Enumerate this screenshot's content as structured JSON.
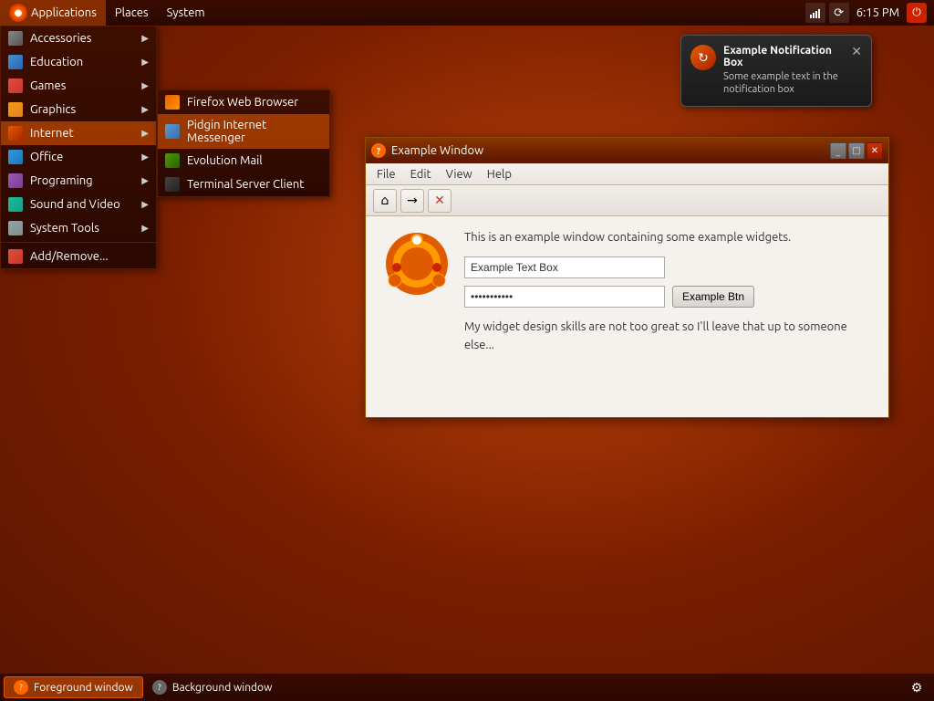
{
  "taskbar_top": {
    "applications_label": "Applications",
    "places_label": "Places",
    "system_label": "System",
    "time": "6:15 PM"
  },
  "apps_menu": {
    "items": [
      {
        "id": "accessories",
        "label": "Accessories",
        "icon_class": "ico-accessories",
        "has_arrow": true
      },
      {
        "id": "education",
        "label": "Education",
        "icon_class": "ico-education",
        "has_arrow": true
      },
      {
        "id": "games",
        "label": "Games",
        "icon_class": "ico-games",
        "has_arrow": true
      },
      {
        "id": "graphics",
        "label": "Graphics",
        "icon_class": "ico-graphics",
        "has_arrow": true
      },
      {
        "id": "internet",
        "label": "Internet",
        "icon_class": "ico-internet",
        "has_arrow": true,
        "active": true
      },
      {
        "id": "office",
        "label": "Office",
        "icon_class": "ico-office",
        "has_arrow": true
      },
      {
        "id": "programming",
        "label": "Programing",
        "icon_class": "ico-programming",
        "has_arrow": true
      },
      {
        "id": "sound",
        "label": "Sound and Video",
        "icon_class": "ico-sound",
        "has_arrow": true
      },
      {
        "id": "systemtools",
        "label": "System Tools",
        "icon_class": "ico-systemtools",
        "has_arrow": true
      },
      {
        "id": "addremove",
        "label": "Add/Remove...",
        "icon_class": "ico-addremove",
        "has_arrow": false
      }
    ]
  },
  "internet_submenu": {
    "items": [
      {
        "id": "firefox",
        "label": "Firefox Web Browser",
        "icon_class": "ico-firefox"
      },
      {
        "id": "pidgin",
        "label": "Pidgin Internet Messenger",
        "icon_class": "ico-pidgin"
      },
      {
        "id": "evolution",
        "label": "Evolution Mail",
        "icon_class": "ico-evolution"
      },
      {
        "id": "termserver",
        "label": "Terminal Server Client",
        "icon_class": "ico-termserver"
      }
    ]
  },
  "example_window": {
    "title": "Example Window",
    "question_icon": "?",
    "menubar": {
      "items": [
        "File",
        "Edit",
        "View",
        "Help"
      ]
    },
    "toolbar": {
      "home_symbol": "⌂",
      "arrow_symbol": "→",
      "close_symbol": "✕"
    },
    "content": {
      "description": "This is an example window containing some example widgets.",
      "textbox_value": "Example Text Box",
      "password_dots": "●●●●●●●●●●●",
      "example_btn_label": "Example Btn",
      "body_text": "My widget design skills are not too great so I'll leave that up to someone else..."
    },
    "controls": {
      "minimize_symbol": "_",
      "maximize_symbol": "□",
      "close_symbol": "✕"
    }
  },
  "notification": {
    "title": "Example Notification Box",
    "text": "Some example text in the notification box",
    "close_symbol": "✕"
  },
  "taskbar_bottom": {
    "foreground_label": "Foreground window",
    "background_label": "Background window"
  }
}
